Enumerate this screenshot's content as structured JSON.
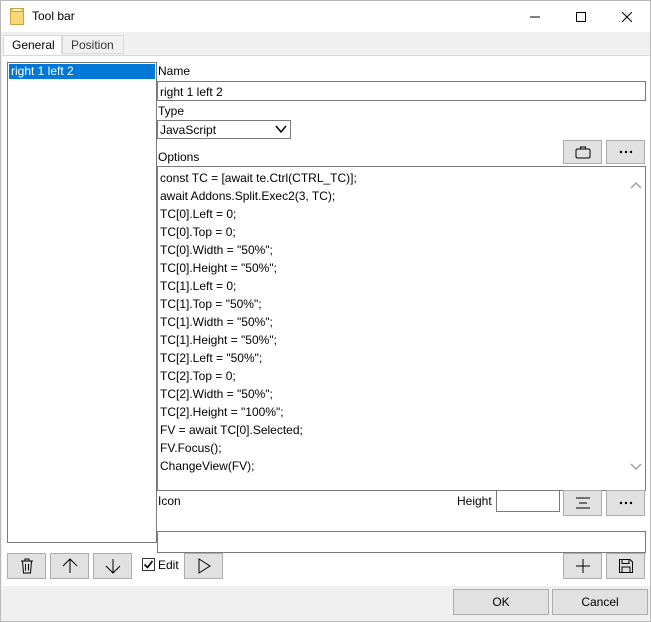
{
  "window": {
    "title": "Tool bar"
  },
  "tabs": [
    {
      "label": "General",
      "active": true
    },
    {
      "label": "Position",
      "active": false
    }
  ],
  "list": {
    "items": [
      "right 1 left 2"
    ]
  },
  "form": {
    "name_label": "Name",
    "name_value": "right 1 left 2",
    "type_label": "Type",
    "type_value": "JavaScript",
    "options_label": "Options",
    "icon_label": "Icon",
    "height_label": "Height",
    "height_value": "",
    "icon_value": ""
  },
  "code_lines": [
    "const TC = [await te.Ctrl(CTRL_TC)];",
    "await Addons.Split.Exec2(3, TC);",
    "TC[0].Left = 0;",
    "TC[0].Top = 0;",
    "TC[0].Width = \"50%\";",
    "TC[0].Height = \"50%\";",
    "TC[1].Left = 0;",
    "TC[1].Top = \"50%\";",
    "TC[1].Width = \"50%\";",
    "TC[1].Height = \"50%\";",
    "TC[2].Left = \"50%\";",
    "TC[2].Top = 0;",
    "TC[2].Width = \"50%\";",
    "TC[2].Height = \"100%\";",
    "FV = await TC[0].Selected;",
    "FV.Focus();",
    "ChangeView(FV);"
  ],
  "controls": {
    "edit_label": "Edit",
    "edit_checked": true,
    "ok_label": "OK",
    "cancel_label": "Cancel"
  },
  "icons": {
    "app": "folder-icon",
    "minimize": "minimize-icon",
    "maximize": "maximize-icon",
    "close": "close-icon",
    "options_folder": "briefcase-icon",
    "more": "ellipsis-icon",
    "align": "align-icon",
    "delete": "trash-icon",
    "up": "arrow-up-icon",
    "down": "arrow-down-icon",
    "run": "play-icon",
    "add": "plus-icon",
    "save": "save-icon"
  },
  "colors": {
    "selection": "#0078d7",
    "border": "#7a7a7a",
    "button_bg": "#e1e1e1"
  }
}
